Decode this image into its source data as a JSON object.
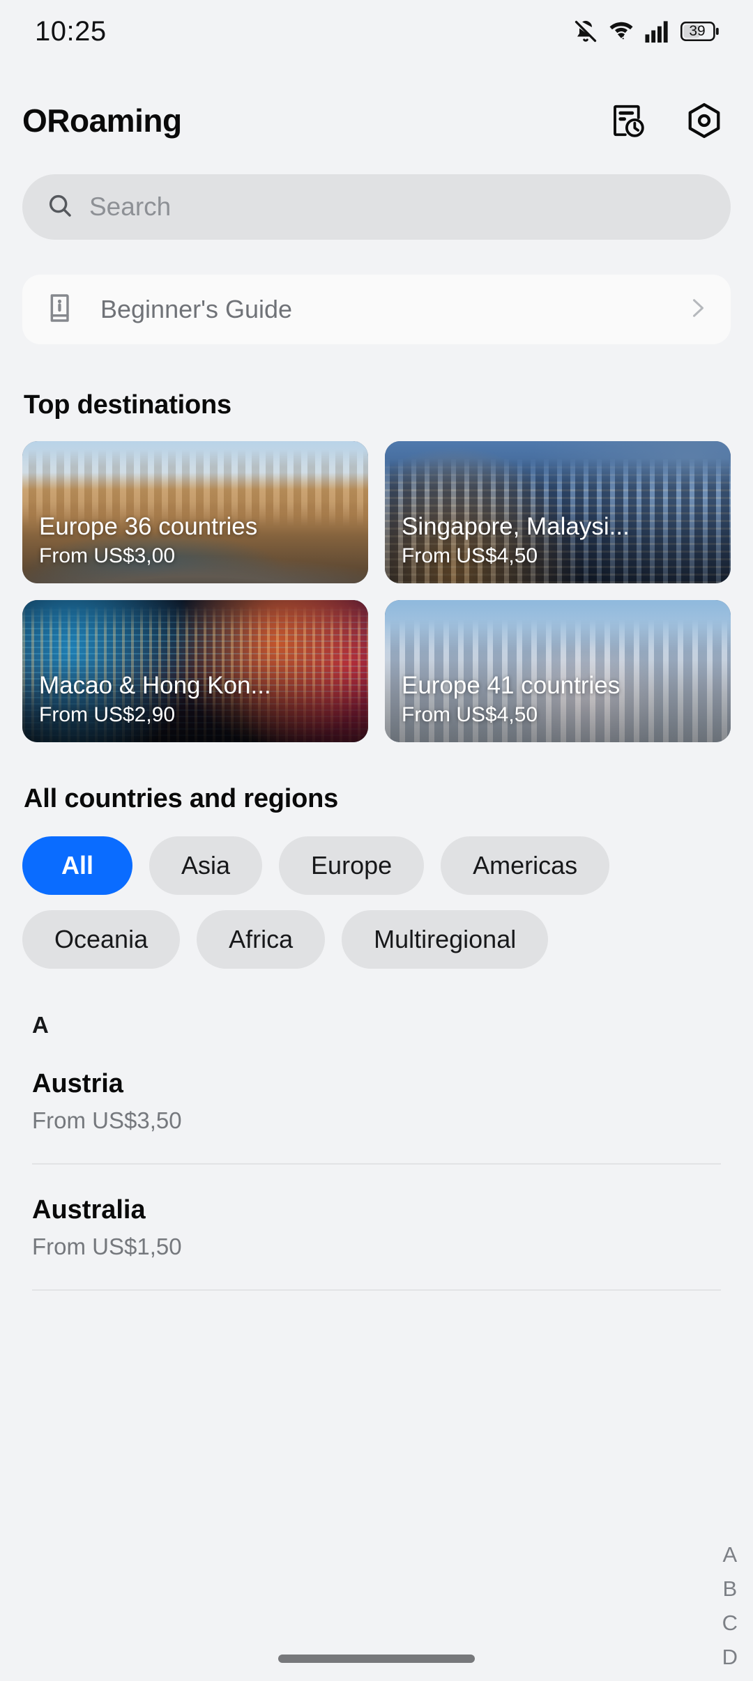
{
  "status_bar": {
    "time": "10:25",
    "battery_level": "39",
    "icons": [
      "bell-muted-icon",
      "wifi-icon",
      "cellular-signal-icon",
      "battery-icon"
    ]
  },
  "header": {
    "title": "ORoaming",
    "actions": [
      {
        "name": "order-history-icon",
        "label": "Order history"
      },
      {
        "name": "settings-hexagon-icon",
        "label": "Settings"
      }
    ]
  },
  "search": {
    "placeholder": "Search",
    "value": "",
    "icon": "search-icon"
  },
  "guide": {
    "label": "Beginner's Guide",
    "icon": "book-info-icon",
    "chevron": "chevron-right-icon"
  },
  "top_destinations": {
    "title": "Top destinations",
    "cards": [
      {
        "name": "Europe 36 countries",
        "price": "From US$3,00",
        "photo": "plaza-de-espana"
      },
      {
        "name": "Singapore, Malaysi...",
        "price": "From US$4,50",
        "photo": "singapore-skyline-dusk"
      },
      {
        "name": "Macao & Hong Kon...",
        "price": "From US$2,90",
        "photo": "hong-kong-night-skyline"
      },
      {
        "name": "Europe 41 countries",
        "price": "From US$4,50",
        "photo": "warsaw-skyline"
      }
    ]
  },
  "all_countries": {
    "title": "All countries and regions",
    "filters": [
      {
        "label": "All",
        "selected": true
      },
      {
        "label": "Asia",
        "selected": false
      },
      {
        "label": "Europe",
        "selected": false
      },
      {
        "label": "Americas",
        "selected": false
      },
      {
        "label": "Oceania",
        "selected": false
      },
      {
        "label": "Africa",
        "selected": false
      },
      {
        "label": "Multiregional",
        "selected": false
      }
    ],
    "section_letter": "A",
    "countries": [
      {
        "name": "Austria",
        "price": "From US$3,50"
      },
      {
        "name": "Australia",
        "price": "From US$1,50"
      }
    ],
    "alphabet_index": [
      "A",
      "B",
      "C",
      "D"
    ]
  },
  "colors": {
    "accent": "#0a6cff",
    "page_background": "#f2f3f5",
    "chip_background": "#e0e1e3",
    "muted_text": "#75787d"
  }
}
